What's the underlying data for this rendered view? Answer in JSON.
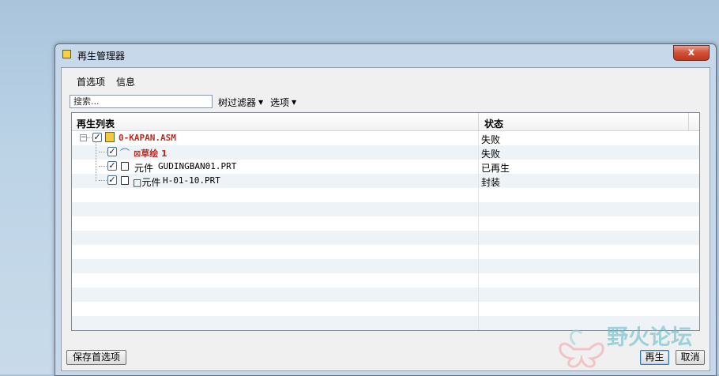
{
  "window": {
    "title": "再生管理器",
    "close_glyph": "x"
  },
  "menu": {
    "items": [
      "首选项",
      "信息"
    ]
  },
  "toolbar": {
    "search_placeholder": "搜索...",
    "filter_label": "树过滤器",
    "options_label": "选项"
  },
  "table": {
    "headers": {
      "name": "再生列表",
      "status": "状态"
    },
    "rows": [
      {
        "prefix": "",
        "name": "0-KAPAN.ASM",
        "status": "失败",
        "type": "assembly",
        "checked": true,
        "error": true
      },
      {
        "prefix": "",
        "name": "⊠草绘 1",
        "status": "失败",
        "type": "sketch",
        "checked": true,
        "error": true
      },
      {
        "prefix": "元件",
        "name": "GUDINGBAN01.PRT",
        "status": "已再生",
        "type": "part",
        "checked": true,
        "error": false
      },
      {
        "prefix": "□元件",
        "name": "H-01-10.PRT",
        "status": "封装",
        "type": "part",
        "checked": true,
        "error": false
      }
    ]
  },
  "buttons": {
    "save_prefs": "保存首选项",
    "regen": "再生",
    "cancel": "取消"
  },
  "watermark": {
    "text": "野火论坛"
  }
}
